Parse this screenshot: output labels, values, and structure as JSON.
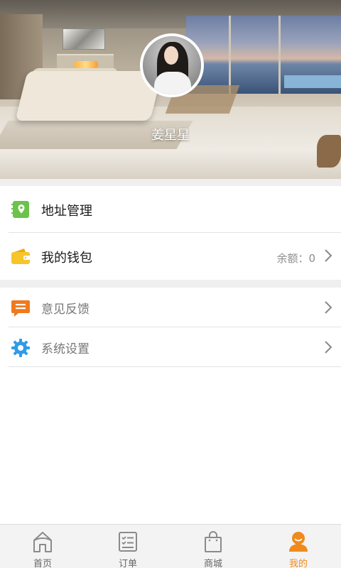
{
  "profile": {
    "username": "姜星星"
  },
  "menu": {
    "address": {
      "label": "地址管理",
      "icon": "location-book-icon",
      "icon_color": "#6cc24a"
    },
    "wallet": {
      "label": "我的钱包",
      "balance_label": "余额：",
      "balance": "0",
      "icon": "wallet-icon",
      "icon_color": "#f7c52b"
    },
    "feedback": {
      "label": "意见反馈",
      "icon": "chat-bubble-icon",
      "icon_color": "#f07a1e"
    },
    "settings": {
      "label": "系统设置",
      "icon": "gear-icon",
      "icon_color": "#2f9ce8"
    }
  },
  "tabs": [
    {
      "label": "首页",
      "icon": "home-icon",
      "active": false
    },
    {
      "label": "订单",
      "icon": "order-list-icon",
      "active": false
    },
    {
      "label": "商城",
      "icon": "shopping-bag-icon",
      "active": false
    },
    {
      "label": "我的",
      "icon": "profile-icon",
      "active": true
    }
  ],
  "colors": {
    "accent": "#f08a1c",
    "divider": "#e3e3e3",
    "section_gap": "#efefef"
  }
}
